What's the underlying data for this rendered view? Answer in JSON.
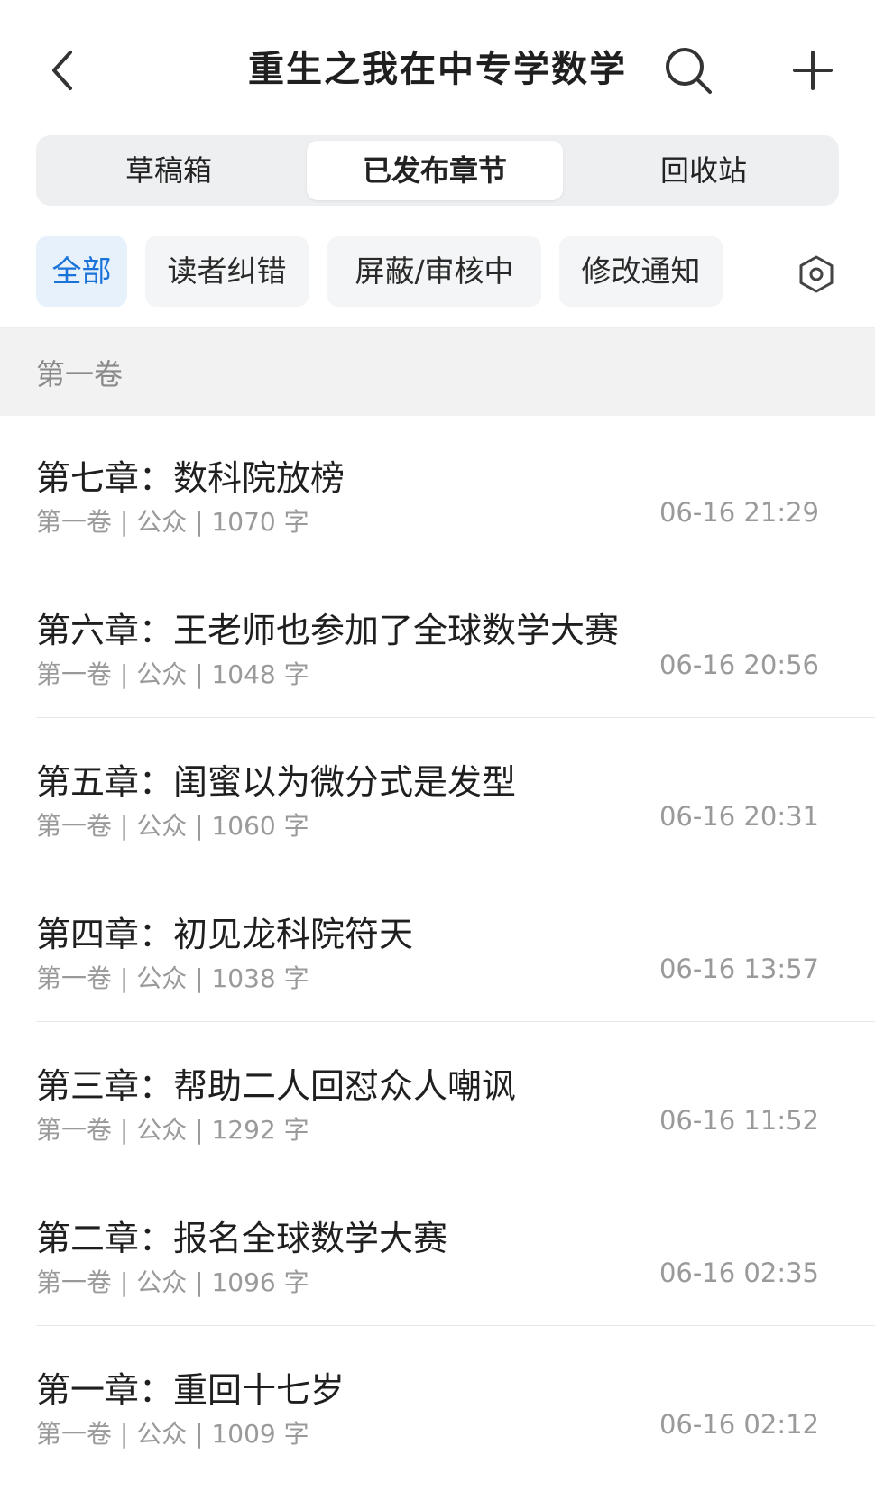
{
  "header": {
    "title": "重生之我在中专学数学",
    "back_icon": "chevron-left-icon",
    "search_icon": "search-icon",
    "add_icon": "plus-icon"
  },
  "tabs": [
    {
      "label": "草稿箱",
      "active": false
    },
    {
      "label": "已发布章节",
      "active": true
    },
    {
      "label": "回收站",
      "active": false
    }
  ],
  "filters": [
    {
      "label": "全部",
      "active": true
    },
    {
      "label": "读者纠错",
      "active": false
    },
    {
      "label": "屏蔽/审核中",
      "active": false
    },
    {
      "label": "修改通知",
      "active": false
    }
  ],
  "settings_icon": "hexagon-settings-icon",
  "volume": {
    "label": "第一卷"
  },
  "chapters": [
    {
      "title": "第七章：数科院放榜",
      "meta": "第一卷 | 公众 | 1070 字",
      "time": "06-16 21:29"
    },
    {
      "title": "第六章：王老师也参加了全球数学大赛",
      "meta": "第一卷 | 公众 | 1048 字",
      "time": "06-16 20:56"
    },
    {
      "title": "第五章：闺蜜以为微分式是发型",
      "meta": "第一卷 | 公众 | 1060 字",
      "time": "06-16 20:31"
    },
    {
      "title": "第四章：初见龙科院符天",
      "meta": "第一卷 | 公众 | 1038 字",
      "time": "06-16 13:57"
    },
    {
      "title": "第三章：帮助二人回怼众人嘲讽",
      "meta": "第一卷 | 公众 | 1292 字",
      "time": "06-16 11:52"
    },
    {
      "title": "第二章：报名全球数学大赛",
      "meta": "第一卷 | 公众 | 1096 字",
      "time": "06-16 02:35"
    },
    {
      "title": "第一章：重回十七岁",
      "meta": "第一卷 | 公众 | 1009 字",
      "time": "06-16 02:12"
    }
  ],
  "colors": {
    "accent": "#1a73d9",
    "accent_bg": "#e6f1fc",
    "muted_text": "#9a9a9a",
    "segment_bg": "#eeeff1"
  }
}
